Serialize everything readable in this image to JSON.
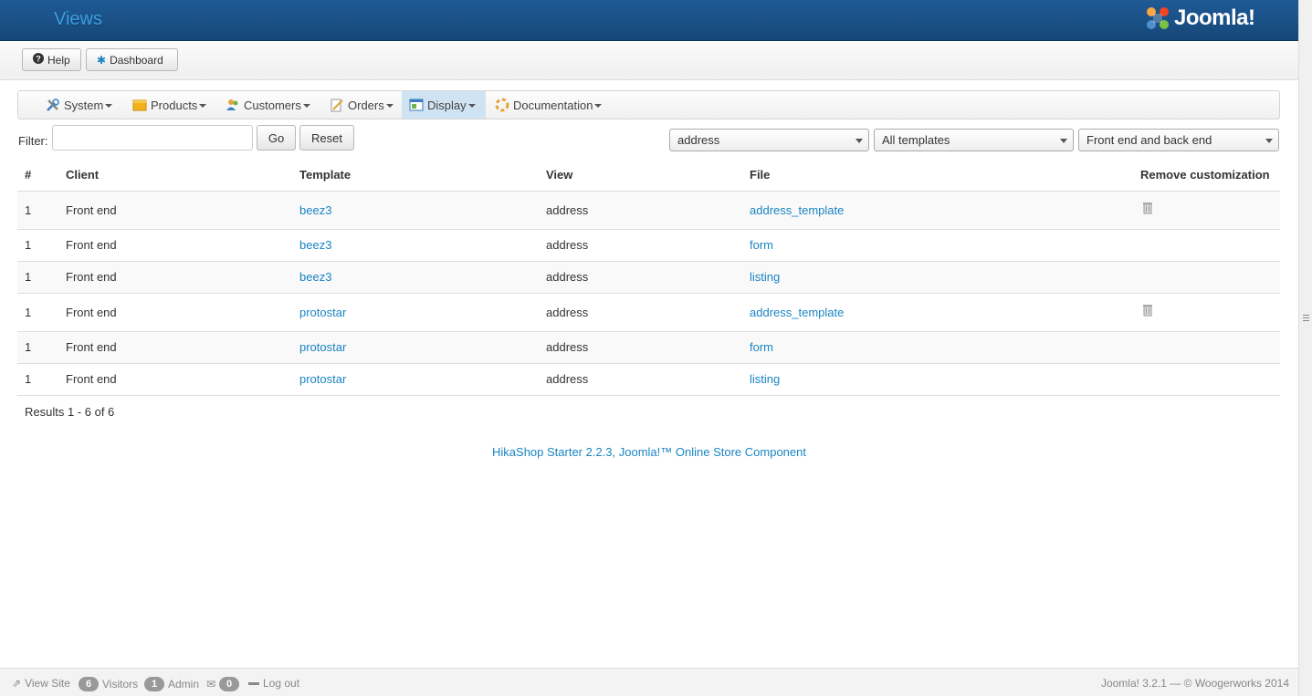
{
  "header": {
    "title": "Views",
    "logo_text": "Joomla!"
  },
  "toolbar": {
    "help_label": "Help",
    "dashboard_label": "Dashboard"
  },
  "menu": {
    "items": [
      {
        "label": "System",
        "icon": "wrench-screwdriver-icon"
      },
      {
        "label": "Products",
        "icon": "box-icon"
      },
      {
        "label": "Customers",
        "icon": "users-icon"
      },
      {
        "label": "Orders",
        "icon": "pencil-document-icon"
      },
      {
        "label": "Display",
        "icon": "window-icon",
        "active": true
      },
      {
        "label": "Documentation",
        "icon": "lifebuoy-icon"
      }
    ]
  },
  "filter": {
    "label": "Filter:",
    "value": "",
    "go_label": "Go",
    "reset_label": "Reset",
    "view_select": "address",
    "template_select": "All templates",
    "client_select": "Front end and back end"
  },
  "table": {
    "headers": [
      "#",
      "Client",
      "Template",
      "View",
      "File",
      "Remove customization"
    ],
    "rows": [
      {
        "num": "1",
        "client": "Front end",
        "template": "beez3",
        "view": "address",
        "file": "address_template",
        "removable": true
      },
      {
        "num": "1",
        "client": "Front end",
        "template": "beez3",
        "view": "address",
        "file": "form",
        "removable": false
      },
      {
        "num": "1",
        "client": "Front end",
        "template": "beez3",
        "view": "address",
        "file": "listing",
        "removable": false
      },
      {
        "num": "1",
        "client": "Front end",
        "template": "protostar",
        "view": "address",
        "file": "address_template",
        "removable": true
      },
      {
        "num": "1",
        "client": "Front end",
        "template": "protostar",
        "view": "address",
        "file": "form",
        "removable": false
      },
      {
        "num": "1",
        "client": "Front end",
        "template": "protostar",
        "view": "address",
        "file": "listing",
        "removable": false
      }
    ]
  },
  "results_text": "Results 1 - 6 of 6",
  "footer_text": "HikaShop Starter 2.2.3, Joomla!™ Online Store Component",
  "status": {
    "view_site": "View Site",
    "visitors_count": "6",
    "visitors_label": "Visitors",
    "admin_count": "1",
    "admin_label": "Admin",
    "messages_count": "0",
    "logout_label": "Log out",
    "copyright": "Joomla! 3.2.1 — © Woogerworks 2014"
  },
  "colors": {
    "header_bg": "#1a5189",
    "link": "#1a84c4",
    "active_menu": "#cfe3f3"
  }
}
